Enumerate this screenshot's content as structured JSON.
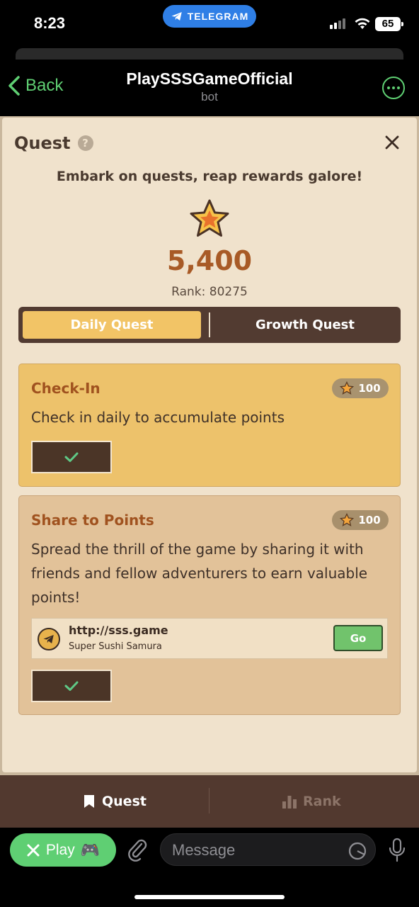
{
  "status_bar": {
    "time": "8:23",
    "telegram_label": "TELEGRAM",
    "battery": "65"
  },
  "header": {
    "back_label": "Back",
    "title": "PlaySSSGameOfficial",
    "subtitle": "bot"
  },
  "quest_panel": {
    "title": "Quest",
    "help_label": "?",
    "tagline": "Embark on quests, reap rewards galore!",
    "points": "5,400",
    "rank": "Rank: 80275",
    "tabs": [
      {
        "label": "Daily Quest",
        "active": true
      },
      {
        "label": "Growth Quest",
        "active": false
      }
    ]
  },
  "quests": [
    {
      "title": "Check-In",
      "reward": "100",
      "description": "Check in daily to accumulate points",
      "completed": true
    },
    {
      "title": "Share to Points",
      "reward": "100",
      "description": "Spread the thrill of the game by sharing it with friends and fellow adventurers to earn valuable points!",
      "link": {
        "url": "http://sss.game",
        "name": "Super Sushi Samura",
        "go_label": "Go"
      },
      "completed": true
    }
  ],
  "bottom_nav": {
    "items": [
      {
        "label": "Quest",
        "active": true
      },
      {
        "label": "Rank",
        "active": false
      }
    ]
  },
  "input_bar": {
    "play_label": "Play",
    "gamepad": "🎮",
    "message_placeholder": "Message"
  },
  "colors": {
    "accent_green": "#5fcf73",
    "panel_bg": "#f0e2cc",
    "dark_brown": "#523b31",
    "gold": "#f2c466",
    "points_orange": "#a85a26"
  }
}
